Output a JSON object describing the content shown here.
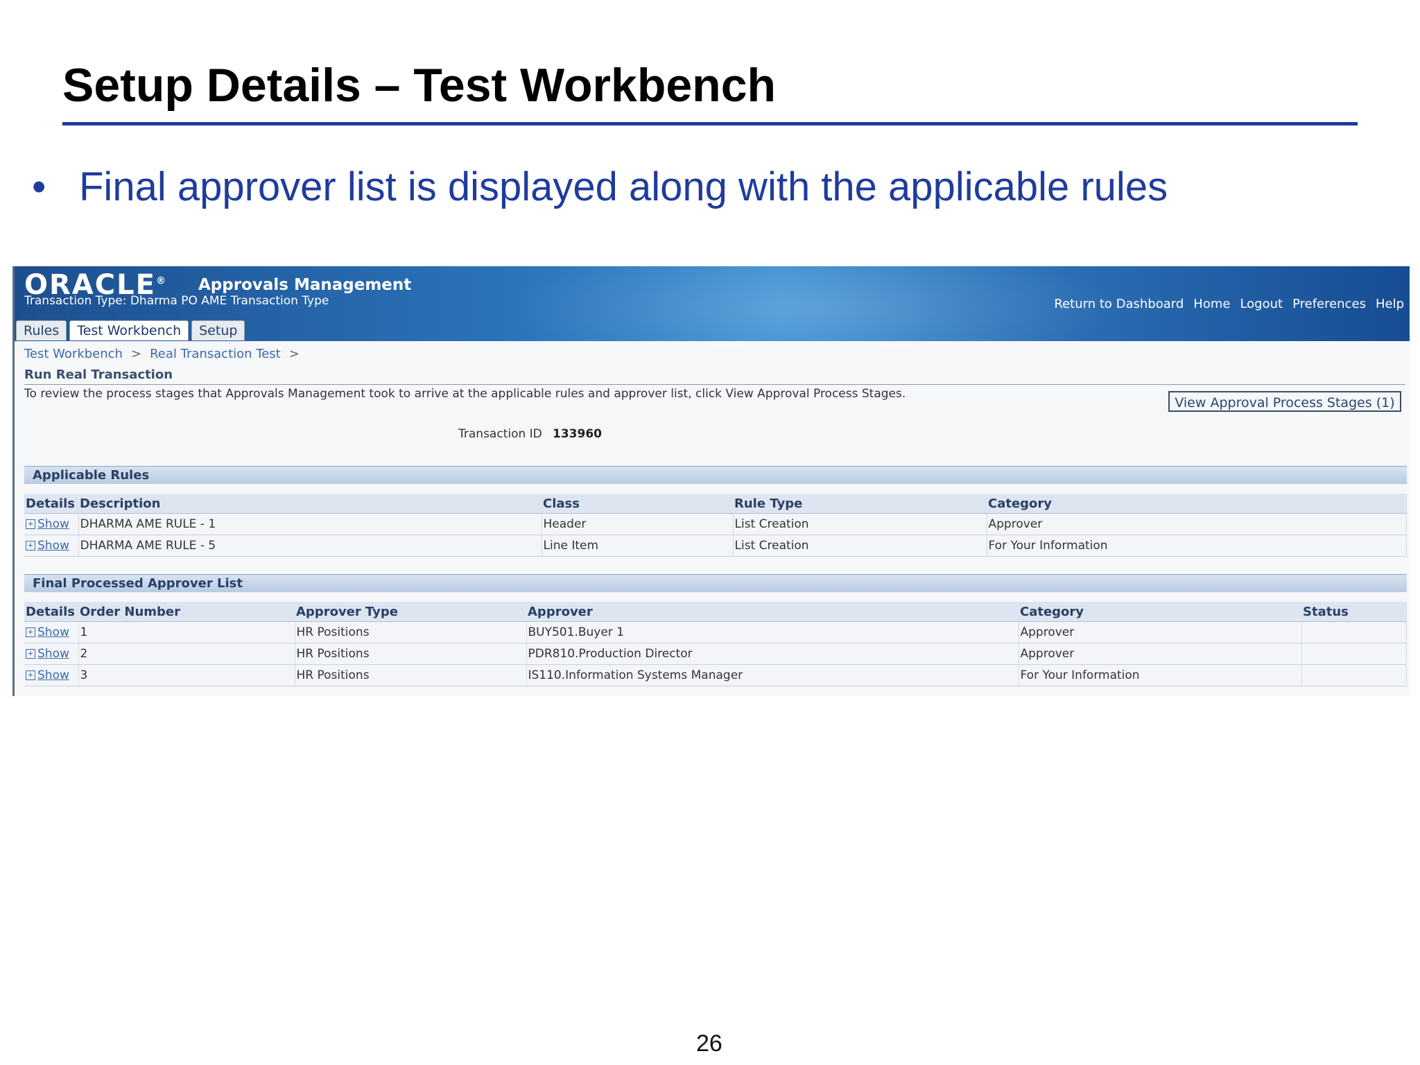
{
  "slide": {
    "title": "Setup Details – Test Workbench",
    "bullet_symbol": "•",
    "bullet": "Final approver list is displayed along with the applicable rules",
    "page_number": "26"
  },
  "app": {
    "logo": "ORACLE",
    "logo_mark": "®",
    "name": "Approvals Management",
    "transaction_type": "Transaction Type: Dharma PO AME Transaction Type",
    "global_links": [
      "Return to Dashboard",
      "Home",
      "Logout",
      "Preferences",
      "Help"
    ],
    "tabs": [
      {
        "label": "Rules",
        "active": false
      },
      {
        "label": "Test Workbench",
        "active": true
      },
      {
        "label": "Setup",
        "active": false
      }
    ],
    "breadcrumbs": [
      "Test Workbench",
      "Real Transaction Test"
    ],
    "breadcrumb_separator": ">"
  },
  "page": {
    "heading": "Run Real Transaction",
    "instructions": "To review the process stages that Approvals Management took to arrive at the applicable rules and approver list, click View Approval Process Stages.",
    "stages_button": "View Approval Process Stages (1)",
    "transaction_id_label": "Transaction ID",
    "transaction_id": "133960"
  },
  "applicable_rules": {
    "title": "Applicable Rules",
    "columns": [
      "Details",
      "Description",
      "Class",
      "Rule Type",
      "Category"
    ],
    "rows": [
      {
        "details": "Show",
        "description": "DHARMA AME RULE - 1",
        "class": "Header",
        "rule_type": "List Creation",
        "category": "Approver"
      },
      {
        "details": "Show",
        "description": "DHARMA AME RULE - 5",
        "class": "Line Item",
        "rule_type": "List Creation",
        "category": "For Your Information"
      }
    ]
  },
  "approver_list": {
    "title": "Final Processed Approver List",
    "columns": [
      "Details",
      "Order Number",
      "Approver Type",
      "Approver",
      "Category",
      "Status"
    ],
    "rows": [
      {
        "details": "Show",
        "order": "1",
        "approver_type": "HR Positions",
        "approver": "BUY501.Buyer 1",
        "category": "Approver",
        "status": ""
      },
      {
        "details": "Show",
        "order": "2",
        "approver_type": "HR Positions",
        "approver": "PDR810.Production Director",
        "category": "Approver",
        "status": ""
      },
      {
        "details": "Show",
        "order": "3",
        "approver_type": "HR Positions",
        "approver": "IS110.Information Systems Manager",
        "category": "For Your Information",
        "status": ""
      }
    ]
  },
  "icons": {
    "expand": "plus-box-icon"
  }
}
